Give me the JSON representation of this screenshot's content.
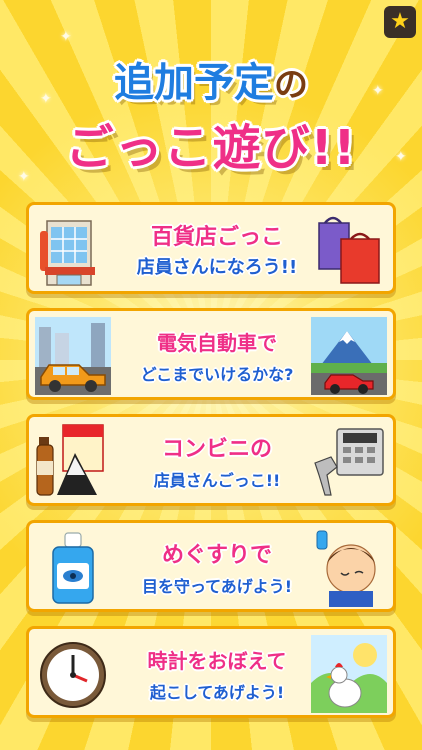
{
  "heading": {
    "line1_main": "追加予定",
    "line1_particle": "の",
    "line2": "ごっこ遊び!!"
  },
  "header_icon": "star-icon",
  "colors": {
    "pink": "#ef2f87",
    "blue": "#1f7de0",
    "card_border": "#f2a500",
    "background": "#fde24a"
  },
  "cards": [
    {
      "line1": "百貨店ごっこ",
      "line2": "店員さんになろう!!",
      "left_icon": "department-store-building",
      "right_icon": "shopping-bags"
    },
    {
      "line1": "電気自動車で",
      "line2": "どこまでいけるかな?",
      "left_icon": "electric-car-city",
      "right_icon": "red-car-mount-fuji"
    },
    {
      "line1": "コンビニの",
      "line2": "店員さんごっこ!!",
      "left_icon": "convenience-store-goods",
      "right_icon": "cash-register-scanner"
    },
    {
      "line1": "めぐすりで",
      "line2": "目を守ってあげよう!",
      "left_icon": "eye-drops-bottle",
      "right_icon": "boy-with-eye-drops"
    },
    {
      "line1": "時計をおぼえて",
      "line2": "起こしてあげよう!",
      "left_icon": "wall-clock",
      "right_icon": "rooster-sunrise"
    }
  ]
}
